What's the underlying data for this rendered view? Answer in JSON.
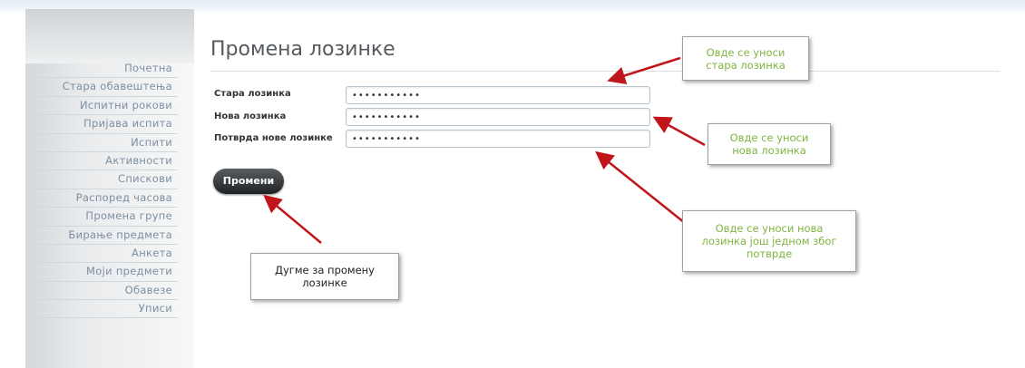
{
  "sidebar": {
    "items": [
      {
        "label": "Почетна"
      },
      {
        "label": "Стара обавештења"
      },
      {
        "label": "Испитни рокови"
      },
      {
        "label": "Пријава испита"
      },
      {
        "label": "Испити"
      },
      {
        "label": "Активности"
      },
      {
        "label": "Спискови"
      },
      {
        "label": "Распоред часова"
      },
      {
        "label": "Промена групе"
      },
      {
        "label": "Бирање предмета"
      },
      {
        "label": "Анкета"
      },
      {
        "label": "Моји предмети"
      },
      {
        "label": "Обавезе"
      },
      {
        "label": "Уписи"
      }
    ]
  },
  "main": {
    "title": "Промена лозинке",
    "fields": {
      "old_password": {
        "label": "Стара лозинка",
        "value": "•••••••••••"
      },
      "new_password": {
        "label": "Нова лозинка",
        "value": "•••••••••••"
      },
      "confirm_password": {
        "label": "Потврда нове лозинке",
        "value": "•••••••••••"
      }
    },
    "submit_label": "Промени"
  },
  "callouts": {
    "old": "Овде се уноси стара лозинка",
    "new": "Овде се уноси нова лозинка",
    "confirm": "Овде се уноси нова лозинка још једном због потврде",
    "button": "Дугме за промену лозинке"
  },
  "colors": {
    "callout_text_green": "#7fb540",
    "arrow": "#c0161b",
    "button_dark": "#2a2d30",
    "nav_text": "#7c8fa1"
  }
}
